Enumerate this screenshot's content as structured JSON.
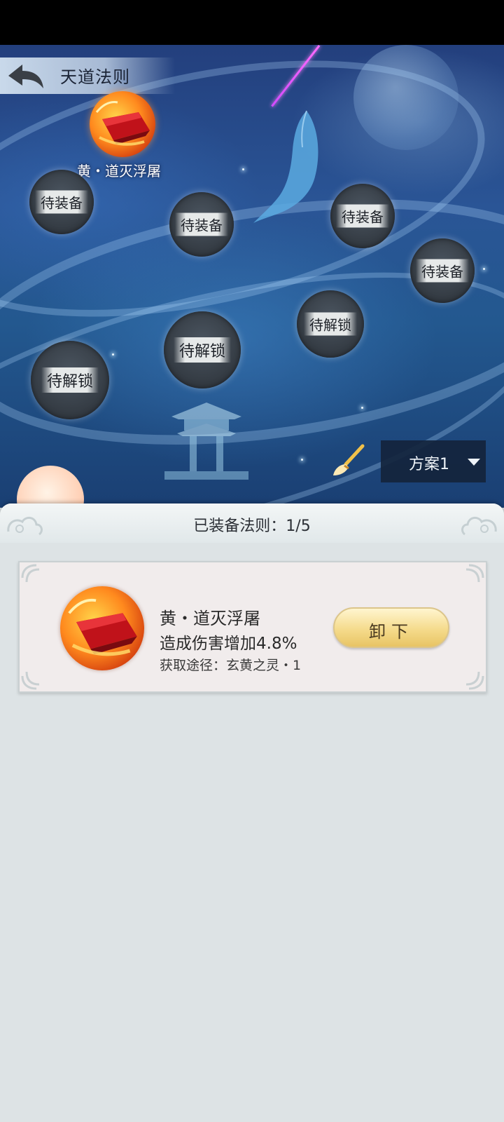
{
  "header": {
    "title": "天道法则"
  },
  "equipped_rule_node": {
    "name": "黄・道灭浮屠"
  },
  "nodes": [
    {
      "label": "待装备"
    },
    {
      "label": "待装备"
    },
    {
      "label": "待装备"
    },
    {
      "label": "待装备"
    },
    {
      "label": "待解锁"
    },
    {
      "label": "待解锁"
    },
    {
      "label": "待解锁"
    }
  ],
  "scheme": {
    "selected": "方案1"
  },
  "panel": {
    "equipped_count_label": "已装备法则：1/5"
  },
  "card": {
    "name": "黄・道灭浮屠",
    "effect": "造成伤害增加4.8%",
    "source": "获取途径：玄黄之灵・1",
    "button_label": "卸下"
  },
  "colors": {
    "scene_bg": "#2a5596",
    "panel_bg": "#dde3e5",
    "button_gold": "#f5db8c",
    "node_dark": "#333a42"
  },
  "icons": [
    "back-arrow-icon",
    "brush-icon",
    "chevron-down-icon",
    "rule-gem-icon"
  ]
}
